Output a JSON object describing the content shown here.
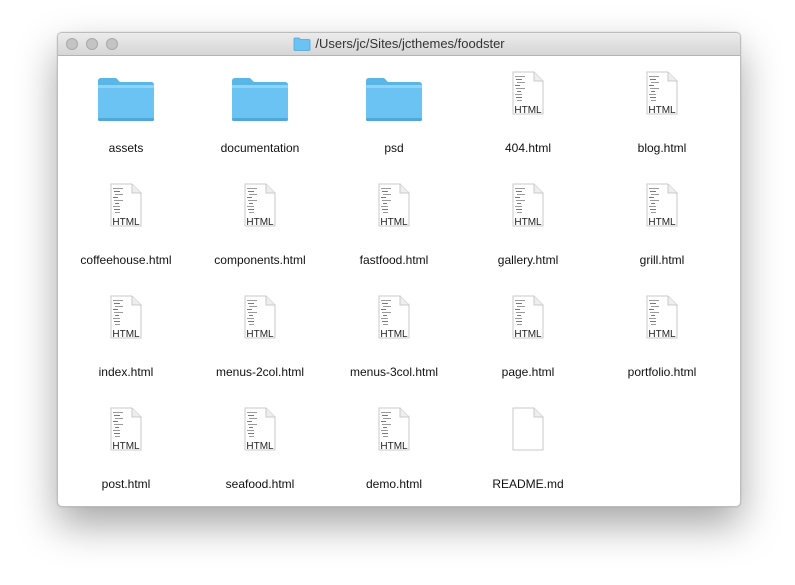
{
  "window": {
    "title": "/Users/jc/Sites/jcthemes/foodster"
  },
  "colors": {
    "folder": "#6ac3f2",
    "folder_tab": "#5ab6e6",
    "doc_border": "#c9c9c9"
  },
  "items": [
    {
      "label": "assets",
      "type": "folder"
    },
    {
      "label": "documentation",
      "type": "folder"
    },
    {
      "label": "psd",
      "type": "folder"
    },
    {
      "label": "404.html",
      "type": "html",
      "tag": "HTML"
    },
    {
      "label": "blog.html",
      "type": "html",
      "tag": "HTML"
    },
    {
      "label": "coffeehouse.html",
      "type": "html",
      "tag": "HTML"
    },
    {
      "label": "components.html",
      "type": "html",
      "tag": "HTML"
    },
    {
      "label": "fastfood.html",
      "type": "html",
      "tag": "HTML"
    },
    {
      "label": "gallery.html",
      "type": "html",
      "tag": "HTML"
    },
    {
      "label": "grill.html",
      "type": "html",
      "tag": "HTML"
    },
    {
      "label": "index.html",
      "type": "html",
      "tag": "HTML"
    },
    {
      "label": "menus-2col.html",
      "type": "html",
      "tag": "HTML"
    },
    {
      "label": "menus-3col.html",
      "type": "html",
      "tag": "HTML"
    },
    {
      "label": "page.html",
      "type": "html",
      "tag": "HTML"
    },
    {
      "label": "portfolio.html",
      "type": "html",
      "tag": "HTML"
    },
    {
      "label": "post.html",
      "type": "html",
      "tag": "HTML"
    },
    {
      "label": "seafood.html",
      "type": "html",
      "tag": "HTML"
    },
    {
      "label": "demo.html",
      "type": "html",
      "tag": "HTML"
    },
    {
      "label": "README.md",
      "type": "md"
    }
  ]
}
